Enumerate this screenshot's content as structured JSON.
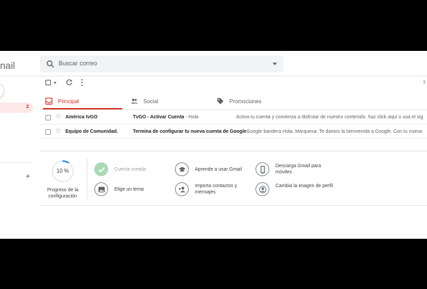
{
  "header": {
    "brand": "nail",
    "search_placeholder": "Buscar correo"
  },
  "sidebar": {
    "inbox_count": "2",
    "add_label": "+"
  },
  "toolbar": {
    "page_indicator": "1"
  },
  "tabs": [
    {
      "label": "Principal",
      "icon": "inbox-icon",
      "active": true
    },
    {
      "label": "Social",
      "icon": "people-icon",
      "active": false
    },
    {
      "label": "Promociones",
      "icon": "tag-icon",
      "active": false
    }
  ],
  "emails": [
    {
      "from": "América tvGO",
      "subject": "TvGO - Activar Cuenta",
      "separator": " - ",
      "preview_inline": "Hola",
      "snippet": "Activa tu cuenta y comienza a disfrutar de nuestro contenido. haz click aquí o usa el sig"
    },
    {
      "from": "Equipo de Comunidad.",
      "subject": "Termina de configurar tu nueva cuenta de Google",
      "separator": " - ",
      "preview_inline": "",
      "snippet": "Google bandera Hola, Marquesa: Te damos la bienvenida a Google. Con tu nueva"
    }
  ],
  "setup": {
    "progress_value": "10 %",
    "progress_fraction": 0.1,
    "progress_label": "Progreso de la configuración",
    "tasks": [
      {
        "label": "Cuenta creada",
        "icon": "check-icon",
        "done": true
      },
      {
        "label": "Elige un tema",
        "icon": "image-icon",
        "done": false
      },
      {
        "label": "Aprende a usar Gmail",
        "icon": "graduation-cap-icon",
        "done": false
      },
      {
        "label": "Importa contactos y mensajes",
        "icon": "add-contact-icon",
        "done": false
      },
      {
        "label": "Descarga Gmail para móviles",
        "icon": "phone-icon",
        "done": false
      },
      {
        "label": "Cambia la imagen de perfil",
        "icon": "profile-icon",
        "done": false
      }
    ]
  },
  "colors": {
    "accent": "#d93025",
    "done_green": "#a8dab5",
    "search_bg": "#f1f3f4"
  }
}
